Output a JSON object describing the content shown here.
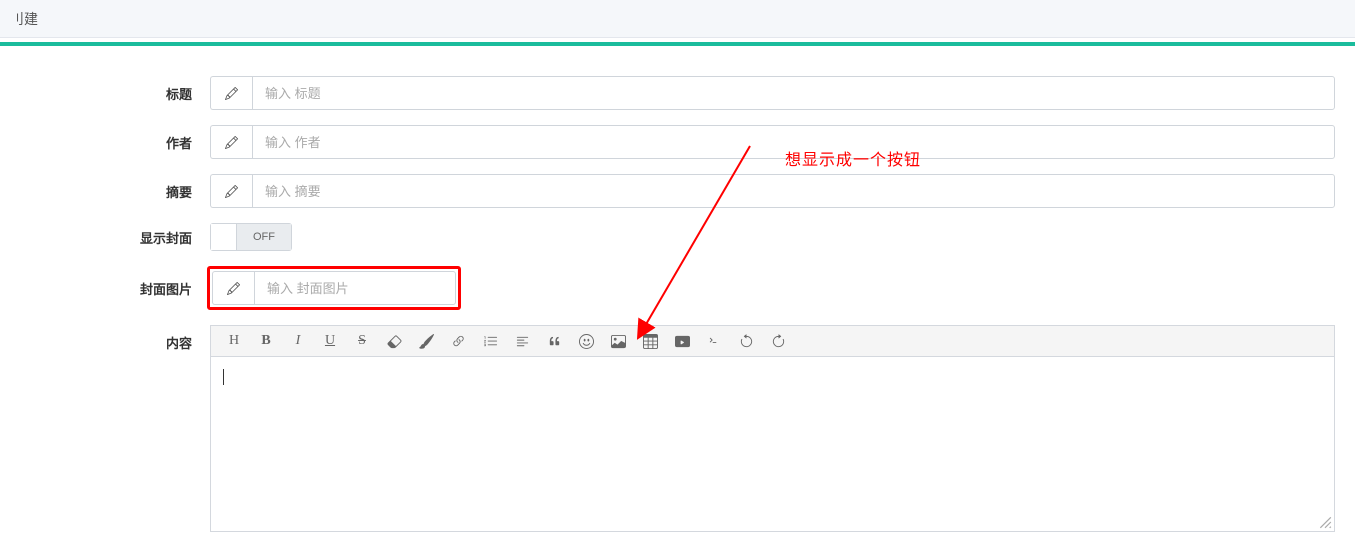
{
  "header": {
    "breadcrumb": "刂建"
  },
  "annotation": {
    "text": "想显示成一个按钮"
  },
  "form": {
    "title": {
      "label": "标题",
      "placeholder": "输入 标题"
    },
    "author": {
      "label": "作者",
      "placeholder": "输入 作者"
    },
    "summary": {
      "label": "摘要",
      "placeholder": "输入 摘要"
    },
    "showCover": {
      "label": "显示封面",
      "toggleState": "OFF"
    },
    "coverImage": {
      "label": "封面图片",
      "placeholder": "输入 封面图片"
    },
    "content": {
      "label": "内容"
    }
  },
  "toolbar": {
    "heading": "H",
    "bold": "B",
    "italic": "I",
    "underline": "U",
    "strikethrough": "S"
  }
}
